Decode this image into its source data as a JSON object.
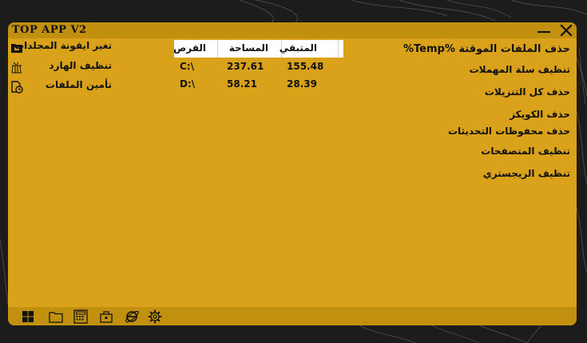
{
  "window": {
    "title": "TOP APP V2"
  },
  "left_menu": {
    "items": [
      {
        "label": "تغير ايقونة المجلدات",
        "icon": "folder-icon"
      },
      {
        "label": "تنظيف الهارد",
        "icon": "broom-icon"
      },
      {
        "label": "تأمين الملفات",
        "icon": "file-lock-icon"
      }
    ]
  },
  "drives_table": {
    "headers": [
      "القرص",
      "المساحة",
      "المتبقي"
    ],
    "rows": [
      [
        "C:\\",
        "237.61",
        "155.48"
      ],
      [
        "D:\\",
        "58.21",
        "28.39"
      ]
    ]
  },
  "right_menu": {
    "items": [
      "حذف الملفات الموقتة %Temp%",
      "تنظيف سلة المهملات",
      "حذف كل التنزيلات",
      "حذف الكويكز",
      "حذف محفوظات التحديثات",
      "تنظيف المتصفحات",
      "تنظيف الريجستري"
    ]
  },
  "bottom_toolbar": {
    "icons": [
      "windows-icon",
      "folder-icon",
      "calculator-icon",
      "toolbox-icon",
      "browser-icon",
      "gear-icon"
    ]
  },
  "colors": {
    "window_bg": "#d9a21a",
    "bar_bg": "#c1900f",
    "desktop_bg": "#1c1c1c",
    "text": "#111111"
  }
}
